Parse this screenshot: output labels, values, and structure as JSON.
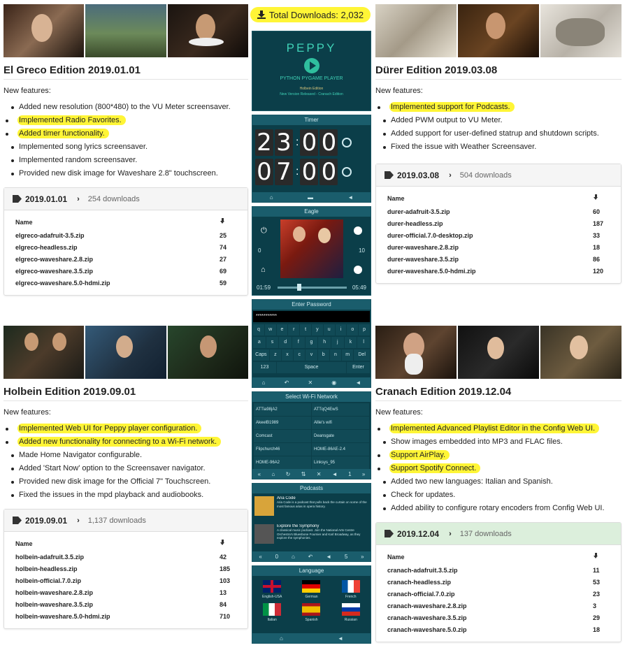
{
  "total_downloads": "Total Downloads: 2,032",
  "el_greco": {
    "title": "El Greco Edition 2019.01.01",
    "new_features": "New features:",
    "features": [
      {
        "text": "Added new resolution (800*480) to the VU Meter screensaver.",
        "hl": false
      },
      {
        "text": "Implemented Radio Favorites.",
        "hl": true
      },
      {
        "text": "Added timer functionality.",
        "hl": true
      },
      {
        "text": "Implemented song lyrics screensaver.",
        "hl": false
      },
      {
        "text": "Implemented random screensaver.",
        "hl": false
      },
      {
        "text": "Provided new disk image for Waveshare 2.8\" touchscreen.",
        "hl": false
      }
    ],
    "release": {
      "version": "2019.01.01",
      "downloads": "254 downloads",
      "name_header": "Name",
      "files": [
        [
          "elgreco-adafruit-3.5.zip",
          "25"
        ],
        [
          "elgreco-headless.zip",
          "74"
        ],
        [
          "elgreco-waveshare.2.8.zip",
          "27"
        ],
        [
          "elgreco-waveshare.3.5.zip",
          "69"
        ],
        [
          "elgreco-waveshare.5.0-hdmi.zip",
          "59"
        ]
      ]
    }
  },
  "durer": {
    "title": "Dürer Edition 2019.03.08",
    "new_features": "New features:",
    "features": [
      {
        "text": "Implemented support for Podcasts.",
        "hl": true
      },
      {
        "text": "Added PWM output to VU Meter.",
        "hl": false
      },
      {
        "text": "Added support for user-defined statrup and shutdown scripts.",
        "hl": false
      },
      {
        "text": "Fixed the issue with Weather Screensaver.",
        "hl": false
      }
    ],
    "release": {
      "version": "2019.03.08",
      "downloads": "504 downloads",
      "name_header": "Name",
      "files": [
        [
          "durer-adafruit-3.5.zip",
          "60"
        ],
        [
          "durer-headless.zip",
          "187"
        ],
        [
          "durer-official.7.0-desktop.zip",
          "33"
        ],
        [
          "durer-waveshare.2.8.zip",
          "18"
        ],
        [
          "durer-waveshare.3.5.zip",
          "86"
        ],
        [
          "durer-waveshare.5.0-hdmi.zip",
          "120"
        ]
      ]
    }
  },
  "holbein": {
    "title": "Holbein Edition 2019.09.01",
    "new_features": "New features:",
    "features": [
      {
        "text": "Implemented Web UI for Peppy player configuration.",
        "hl": true
      },
      {
        "text": "Added new functionality for connecting to a Wi-Fi network.",
        "hl": true
      },
      {
        "text": "Made Home Navigator configurable.",
        "hl": false
      },
      {
        "text": "Added 'Start Now' option to the Screensaver navigator.",
        "hl": false
      },
      {
        "text": "Provided new disk image for the Official 7\" Touchscreen.",
        "hl": false
      },
      {
        "text": "Fixed the issues in the mpd playback and audiobooks.",
        "hl": false
      }
    ],
    "release": {
      "version": "2019.09.01",
      "downloads": "1,137 downloads",
      "name_header": "Name",
      "files": [
        [
          "holbein-adafruit.3.5.zip",
          "42"
        ],
        [
          "holbein-headless.zip",
          "185"
        ],
        [
          "holbein-official.7.0.zip",
          "103"
        ],
        [
          "holbein-waveshare.2.8.zip",
          "13"
        ],
        [
          "holbein-waveshare.3.5.zip",
          "84"
        ],
        [
          "holbein-waveshare.5.0-hdmi.zip",
          "710"
        ]
      ]
    }
  },
  "cranach": {
    "title": "Cranach Edition 2019.12.04",
    "new_features": "New features:",
    "features": [
      {
        "text": "Implemented Advanced Playlist Editor in the Config Web UI.",
        "hl": true
      },
      {
        "text": "Show images embedded into MP3 and FLAC files.",
        "hl": false
      },
      {
        "text": "Support AirPlay.",
        "hl": true
      },
      {
        "text": "Support Spotify Connect.",
        "hl": true
      },
      {
        "text": "Added two new languages: Italian and Spanish.",
        "hl": false
      },
      {
        "text": "Check for updates.",
        "hl": false
      },
      {
        "text": "Added ability to configure rotary encoders from Config Web UI.",
        "hl": false
      }
    ],
    "release": {
      "version": "2019.12.04",
      "downloads": "137 downloads",
      "name_header": "Name",
      "files": [
        [
          "cranach-adafruit.3.5.zip",
          "11"
        ],
        [
          "cranach-headless.zip",
          "53"
        ],
        [
          "cranach-official.7.0.zip",
          "23"
        ],
        [
          "cranach-waveshare.2.8.zip",
          "3"
        ],
        [
          "cranach-waveshare.3.5.zip",
          "29"
        ],
        [
          "cranach-waveshare.5.0.zip",
          "18"
        ]
      ]
    }
  },
  "screens": {
    "peppy": {
      "logo": "PEPPY",
      "subtitle": "PYTHON PYGAME PLAYER",
      "edition": "Holbein Edition",
      "released": "New Version Released - Cranach Edition"
    },
    "timer": {
      "title": "Timer",
      "time1": [
        "2",
        "3",
        "0",
        "0"
      ],
      "time2": [
        "0",
        "7",
        "0",
        "0"
      ]
    },
    "eagle": {
      "title": "Eagle",
      "left": "0",
      "right": "10",
      "start": "01:59",
      "end": "05:49"
    },
    "password": {
      "title": "Enter Password",
      "value": "***********",
      "row1": [
        "q",
        "w",
        "e",
        "r",
        "t",
        "y",
        "u",
        "i",
        "o",
        "p"
      ],
      "row2": [
        "a",
        "s",
        "d",
        "f",
        "g",
        "h",
        "j",
        "k",
        "l"
      ],
      "row3": [
        "Caps",
        "z",
        "x",
        "c",
        "v",
        "b",
        "n",
        "m",
        "Del"
      ],
      "row4": [
        "123",
        "Space",
        "Enter"
      ]
    },
    "wifi": {
      "title": "Select Wi-Fi Network",
      "networks": [
        "ATTia98jA2",
        "ATTqQ4EwS",
        "AkeelB1989",
        "Allie's wifi",
        "Comcast",
        "Deansgate",
        "Flipchurch46",
        "HOME-86AE-2.4",
        "HOME-96A2",
        "Linksys_95"
      ],
      "page": "1"
    },
    "podcasts": {
      "title": "Podcasts",
      "items": [
        {
          "name": "Aria Code",
          "desc": "Aria Code is a podcast that pulls back the curtain on some of the most famous arias in opera history."
        },
        {
          "name": "Explore the Symphony",
          "desc": "A classical music podcast. Join the National Arts Centre Orchestra's Bluesbone Fournier and Karl Broadway, as they explore the symphonies."
        }
      ],
      "left": "0",
      "right": "5"
    },
    "language": {
      "title": "Language",
      "langs": [
        "English-USA",
        "German",
        "French",
        "Italian",
        "Spanish",
        "Russian"
      ]
    }
  },
  "colors": {
    "highlight": "#fff536",
    "panel": "#0b3e49",
    "panel_header": "#1a5d6c"
  }
}
